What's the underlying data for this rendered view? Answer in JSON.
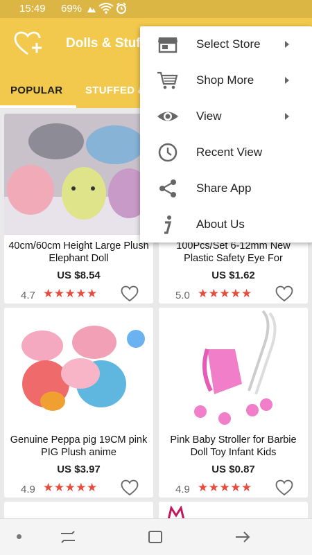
{
  "status_bar": {
    "time": "15:49",
    "battery": "69%",
    "icons": [
      "image-icon",
      "signal-icon",
      "wifi-icon",
      "alarm-icon"
    ]
  },
  "app_bar": {
    "title": "Dolls & Stuffed Toys",
    "logo_icon": "heart-plus-icon"
  },
  "tabs": [
    {
      "label": "POPULAR",
      "active": true
    },
    {
      "label": "STUFFED & PLUSH",
      "active": false
    }
  ],
  "products": [
    {
      "name": "40cm/60cm Height Large Plush Elephant Doll",
      "price": "US $8.54",
      "rating": "4.7",
      "stars": "★★★★★"
    },
    {
      "name": "100Pcs/Set 6-12mm New Plastic Safety Eye For",
      "price": "US $1.62",
      "rating": "5.0",
      "stars": "★★★★★"
    },
    {
      "name": "Genuine Peppa pig 19CM pink PIG Plush anime",
      "price": "US $3.97",
      "rating": "4.9",
      "stars": "★★★★★"
    },
    {
      "name": "Pink Baby Stroller for Barbie Doll Toy Infant Kids",
      "price": "US $0.87",
      "rating": "4.9",
      "stars": "★★★★★"
    }
  ],
  "menu": {
    "items": [
      {
        "label": "Select Store",
        "icon": "store-icon",
        "has_submenu": true
      },
      {
        "label": "Shop More",
        "icon": "cart-icon",
        "has_submenu": true
      },
      {
        "label": "View",
        "icon": "eye-icon",
        "has_submenu": true
      },
      {
        "label": "Recent View",
        "icon": "clock-icon",
        "has_submenu": false
      },
      {
        "label": "Share App",
        "icon": "share-icon",
        "has_submenu": false
      },
      {
        "label": "About Us",
        "icon": "info-icon",
        "has_submenu": false
      }
    ]
  },
  "colors": {
    "accent": "#f2c94c",
    "status_bar": "#dcb645",
    "star": "#e74c3c"
  }
}
